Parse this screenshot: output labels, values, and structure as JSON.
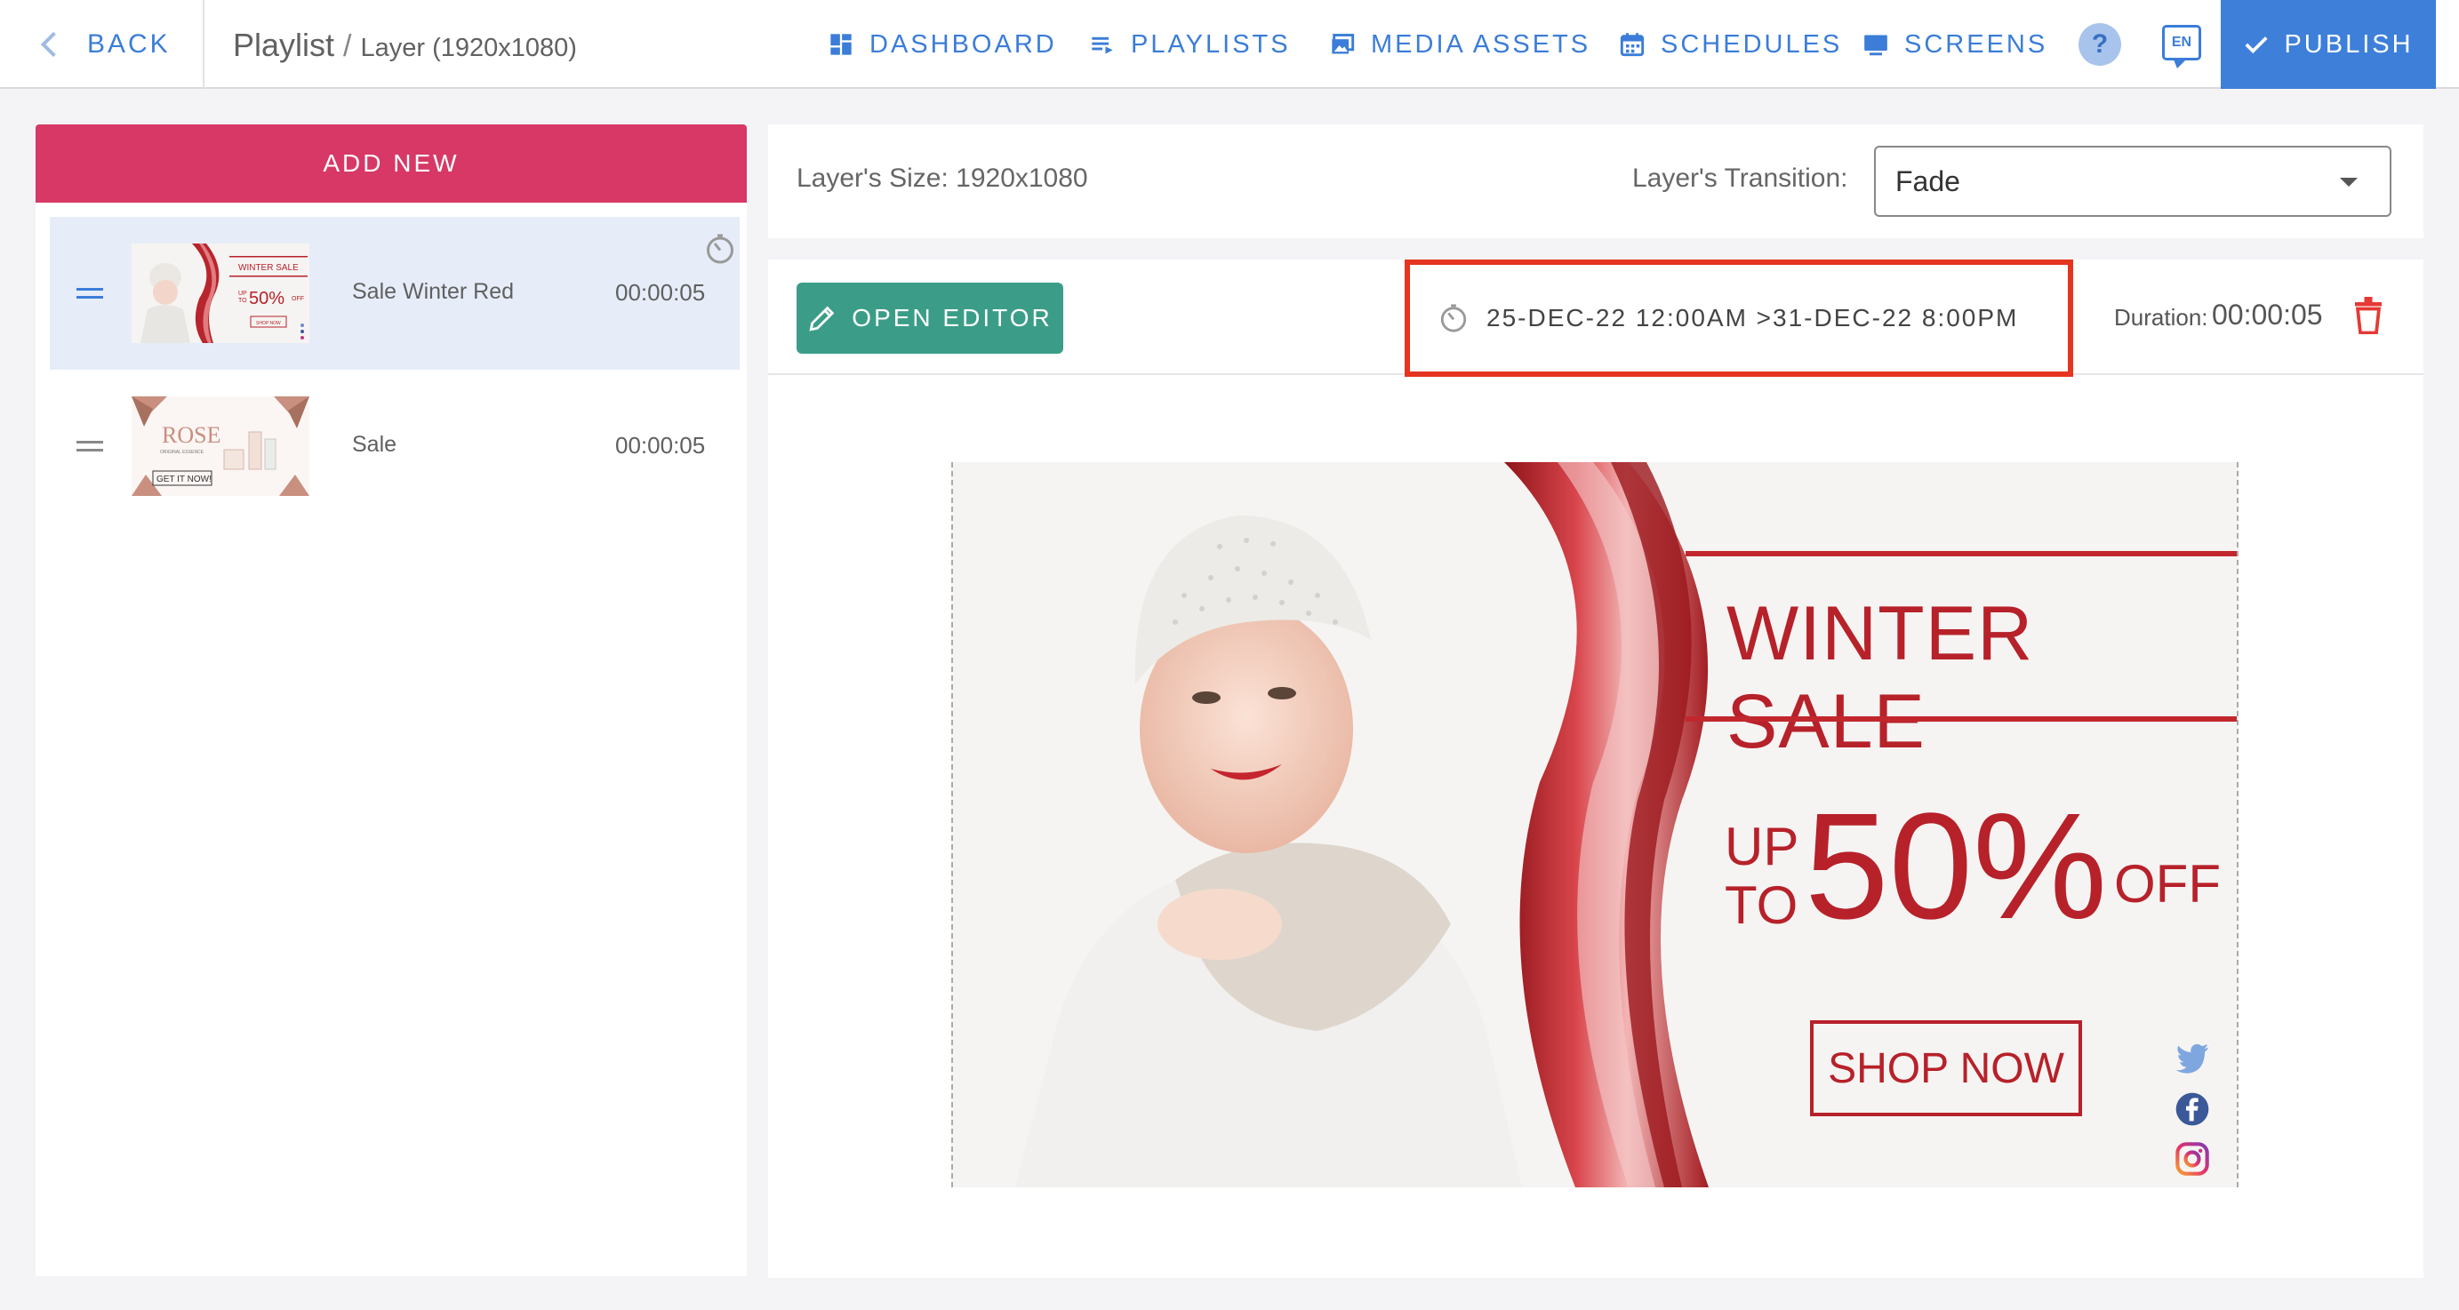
{
  "topbar": {
    "back_label": "BACK",
    "breadcrumb_root": "Playlist",
    "breadcrumb_sep": "/",
    "breadcrumb_current": "Layer (1920x1080)",
    "nav": {
      "dashboard": "DASHBOARD",
      "playlists": "PLAYLISTS",
      "media_assets": "MEDIA ASSETS",
      "schedules": "SCHEDULES",
      "screens": "SCREENS"
    },
    "help": "?",
    "language": "EN",
    "publish_label": "PUBLISH",
    "accent_color": "#3d7fd9"
  },
  "sidebar": {
    "add_new_label": "ADD NEW",
    "add_new_color": "#d73865",
    "items": [
      {
        "name": "Sale Winter Red",
        "duration": "00:00:05",
        "selected": true,
        "thumb_text": {
          "title": "WINTER SALE",
          "up": "UP",
          "to": "TO",
          "pct": "50%",
          "off": "OFF",
          "shop": "SHOP NOW"
        }
      },
      {
        "name": "Sale",
        "duration": "00:00:05",
        "selected": false,
        "thumb_text": {
          "title": "ROSE",
          "sub": "ORIGINAL ESSENCE",
          "cta": "GET IT NOW!"
        }
      }
    ]
  },
  "layer": {
    "size_label": "Layer's Size: 1920x1080",
    "transition_label": "Layer's Transition:",
    "transition_value": "Fade"
  },
  "editor": {
    "open_editor_label": "OPEN EDITOR",
    "schedule_range": "25-DEC-22 12:00AM >31-DEC-22 8:00PM",
    "duration_label": "Duration:",
    "duration_value": "00:00:05",
    "open_editor_color": "#3b9d88",
    "highlight_color": "#e5341f"
  },
  "banner": {
    "title": "WINTER SALE",
    "up": "UP",
    "to": "TO",
    "percent": "50%",
    "off": "OFF",
    "cta": "SHOP NOW",
    "accent_color": "#b7212a",
    "social_icons": [
      "twitter-icon",
      "facebook-icon",
      "instagram-icon"
    ]
  }
}
